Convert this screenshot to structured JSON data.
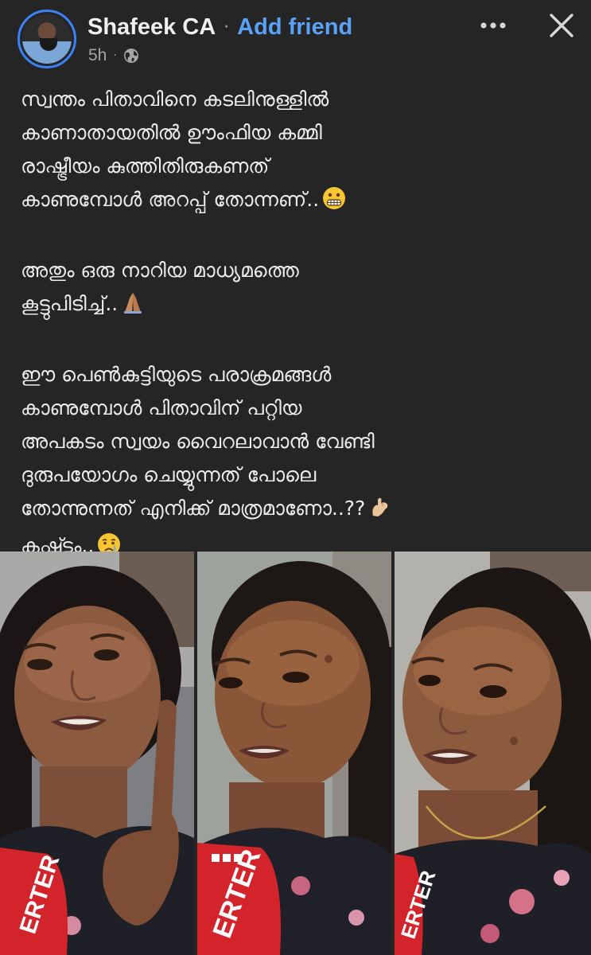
{
  "post": {
    "author": {
      "name": "Shafeek CA",
      "separator": "·",
      "add_friend_label": "Add friend"
    },
    "meta": {
      "time": "5h",
      "separator": "·",
      "audience_icon": "globe-icon"
    },
    "actions": {
      "more_icon": "more-horizontal-icon",
      "close_icon": "close-icon"
    },
    "text": {
      "p1_lines": [
        "സ്വന്തം പിതാവിനെ കടലിനുള്ളിൽ",
        "കാണാതായതിൽ ഊംഫിയ കമ്മി",
        "രാഷ്ട്രീയം കുത്തിതിരുകണത്",
        "കാണുമ്പോൾ അറപ്പ് തോന്നണ്.."
      ],
      "p2_lines": [
        "അതും ഒരു നാറിയ മാധ്യമത്തെ",
        "കൂട്ടുപിടിച്ച്.."
      ],
      "p3_lines": [
        "ഈ പെൺകുട്ടിയുടെ പരാക്രമങ്ങൾ",
        "കാണുമ്പോൾ പിതാവിന് പറ്റിയ",
        "അപകടം സ്വയം വൈറലാവാൻ വേണ്ടി",
        "ദുരുപയോഗം ചെയ്യുന്നത് പോലെ",
        "തോന്നുന്നത് എനിക്ക് മാത്രമാണോ..??",
        "കഷ്ട്ടം.."
      ],
      "emojis": [
        "grimacing-face-emoji",
        "folded-hands-emoji",
        "pinching-hand-emoji",
        "crying-face-emoji"
      ]
    },
    "photos": [
      {
        "name": "photo-1",
        "mic_text": "ERTER"
      },
      {
        "name": "photo-2",
        "mic_text": "ERTER"
      },
      {
        "name": "photo-3",
        "mic_text": "ERTER"
      }
    ]
  },
  "colors": {
    "background": "#252526",
    "text": "#ececee",
    "accent_link": "#5aa2f7",
    "avatar_ring": "#3b82f6",
    "muted": "#a6a6aa"
  }
}
